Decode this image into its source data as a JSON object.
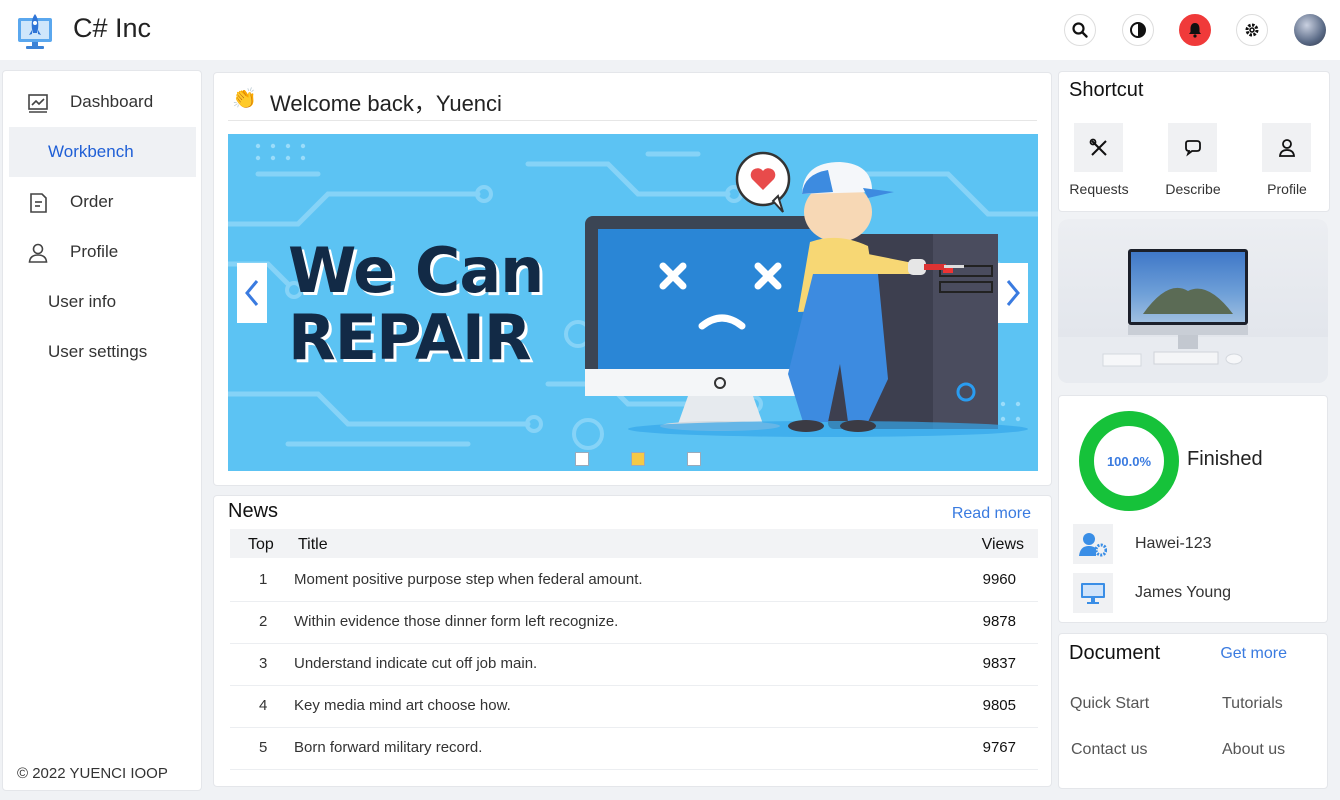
{
  "header": {
    "brand": "C# Inc",
    "icons": [
      "rocket-monitor-logo",
      "search-icon",
      "contrast-icon",
      "bell-icon",
      "gear-icon",
      "avatar"
    ],
    "bell_color": "#f03a3a"
  },
  "sidebar": {
    "items": [
      {
        "label": "Dashboard",
        "icon": "chart-icon"
      },
      {
        "label": "Workbench",
        "active": true
      },
      {
        "label": "Order",
        "icon": "document-icon"
      },
      {
        "label": "Profile",
        "icon": "user-icon"
      },
      {
        "label": "User info"
      },
      {
        "label": "User settings"
      }
    ],
    "copyright": "© 2022 YUENCI IOOP",
    "active_color": "#1f5fd6"
  },
  "welcome": {
    "emoji": "👏",
    "text": "Welcome back，Yuenci",
    "banner": {
      "line1": "We Can",
      "line2": "REPAIR",
      "active_slide": 2,
      "slide_count": 3
    }
  },
  "news": {
    "title": "News",
    "read_more": "Read more",
    "columns": [
      "Top",
      "Title",
      "Views"
    ],
    "rows": [
      {
        "rank": "1",
        "title": "Moment positive purpose step when federal amount.",
        "views": "9960"
      },
      {
        "rank": "2",
        "title": "Within evidence those dinner form left recognize.",
        "views": "9878"
      },
      {
        "rank": "3",
        "title": "Understand indicate cut off job main.",
        "views": "9837"
      },
      {
        "rank": "4",
        "title": "Key media mind art choose how.",
        "views": "9805"
      },
      {
        "rank": "5",
        "title": "Born forward military record.",
        "views": "9767"
      }
    ]
  },
  "shortcut": {
    "title": "Shortcut",
    "items": [
      {
        "label": "Requests",
        "icon": "tools-icon"
      },
      {
        "label": "Describe",
        "icon": "chat-icon"
      },
      {
        "label": "Profile",
        "icon": "user-icon"
      }
    ]
  },
  "progress": {
    "percent_text": "100.0%",
    "percent": 100,
    "status": "Finished",
    "ring_color": "#16c23a",
    "users": [
      {
        "name": "Hawei-123",
        "icon": "user-settings-icon"
      },
      {
        "name": "James Young",
        "icon": "monitor-icon"
      }
    ]
  },
  "document": {
    "title": "Document",
    "get_more": "Get more",
    "links": [
      "Quick Start",
      "Tutorials",
      "Contact us",
      "About us"
    ]
  }
}
